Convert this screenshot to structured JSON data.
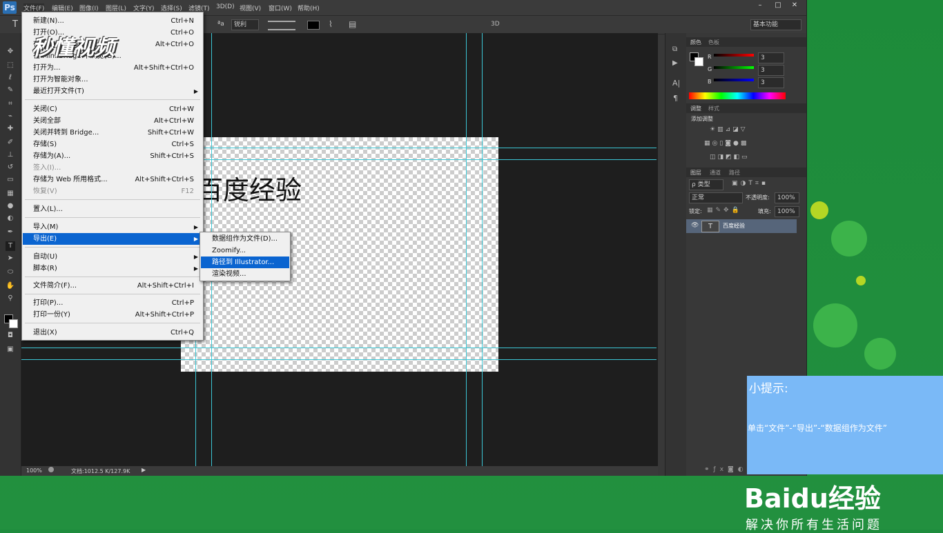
{
  "app": {
    "logo": "Ps"
  },
  "menubar": [
    "文件(F)",
    "编辑(E)",
    "图像(I)",
    "图层(L)",
    "文字(Y)",
    "选择(S)",
    "滤镜(T)",
    "3D(D)",
    "视图(V)",
    "窗口(W)",
    "帮助(H)"
  ],
  "window_buttons": [
    "–",
    "□",
    "✕"
  ],
  "options": {
    "tool_icon": "T",
    "aa_icon": "ªa",
    "aa_value": "锐利",
    "mode3d": "3D",
    "workspace": "基本功能"
  },
  "file_menu": [
    {
      "label": "新建(N)...",
      "shortcut": "Ctrl+N",
      "state": "normal"
    },
    {
      "label": "打开(O)...",
      "shortcut": "Ctrl+O",
      "state": "normal"
    },
    {
      "label": "在 Bridge 中浏览(B)...",
      "shortcut": "Alt+Ctrl+O",
      "state": "normal"
    },
    {
      "label": "在 Mini Bridge 中浏览(G)...",
      "shortcut": "",
      "state": "normal"
    },
    {
      "label": "打开为...",
      "shortcut": "Alt+Shift+Ctrl+O",
      "state": "normal"
    },
    {
      "label": "打开为智能对象...",
      "shortcut": "",
      "state": "normal"
    },
    {
      "label": "最近打开文件(T)",
      "shortcut": "",
      "state": "submenu"
    },
    {
      "label": "关闭(C)",
      "shortcut": "Ctrl+W",
      "state": "normal"
    },
    {
      "label": "关闭全部",
      "shortcut": "Alt+Ctrl+W",
      "state": "normal"
    },
    {
      "label": "关闭并转到 Bridge...",
      "shortcut": "Shift+Ctrl+W",
      "state": "normal"
    },
    {
      "label": "存储(S)",
      "shortcut": "Ctrl+S",
      "state": "normal"
    },
    {
      "label": "存储为(A)...",
      "shortcut": "Shift+Ctrl+S",
      "state": "normal"
    },
    {
      "label": "签入(I)...",
      "shortcut": "",
      "state": "disabled"
    },
    {
      "label": "存储为 Web 所用格式...",
      "shortcut": "Alt+Shift+Ctrl+S",
      "state": "normal"
    },
    {
      "label": "恢复(V)",
      "shortcut": "F12",
      "state": "disabled"
    },
    {
      "label": "置入(L)...",
      "shortcut": "",
      "state": "normal"
    },
    {
      "label": "导入(M)",
      "shortcut": "",
      "state": "submenu"
    },
    {
      "label": "导出(E)",
      "shortcut": "",
      "state": "highlight"
    },
    {
      "label": "自动(U)",
      "shortcut": "",
      "state": "submenu"
    },
    {
      "label": "脚本(R)",
      "shortcut": "",
      "state": "submenu"
    },
    {
      "label": "文件简介(F)...",
      "shortcut": "Alt+Shift+Ctrl+I",
      "state": "normal"
    },
    {
      "label": "打印(P)...",
      "shortcut": "Ctrl+P",
      "state": "normal"
    },
    {
      "label": "打印一份(Y)",
      "shortcut": "Alt+Shift+Ctrl+P",
      "state": "normal"
    },
    {
      "label": "退出(X)",
      "shortcut": "Ctrl+Q",
      "state": "normal"
    }
  ],
  "export_submenu": [
    "数据组作为文件(D)...",
    "Zoomify...",
    "路径到 Illustrator...",
    "渲染视频..."
  ],
  "watermark": "秒懂视频",
  "document": {
    "text": "百度经验"
  },
  "status": {
    "zoom": "100%",
    "doc_info": "文档:1012.5 K/127.9K"
  },
  "panels": {
    "color_tabs": [
      "颜色",
      "色板"
    ],
    "rgb": [
      {
        "ch": "R",
        "val": "3"
      },
      {
        "ch": "G",
        "val": "3"
      },
      {
        "ch": "B",
        "val": "3"
      }
    ],
    "adjust_tabs": [
      "调整",
      "样式"
    ],
    "add_adjust": "添加调整",
    "layer_tabs": [
      "图层",
      "通道",
      "路径"
    ],
    "kind": "ρ 类型",
    "blend": "正常",
    "opacity_label": "不透明度:",
    "opacity": "100%",
    "lock_label": "锁定:",
    "fill_label": "填充:",
    "fill": "100%",
    "layer_name": "百度经验"
  },
  "tip": {
    "title": "小提示:",
    "body": "单击“文件”-“导出”-“数据组作为文件”"
  },
  "baidu": {
    "logo": "Baidu经验",
    "slogan": "解决你所有生活问题"
  }
}
